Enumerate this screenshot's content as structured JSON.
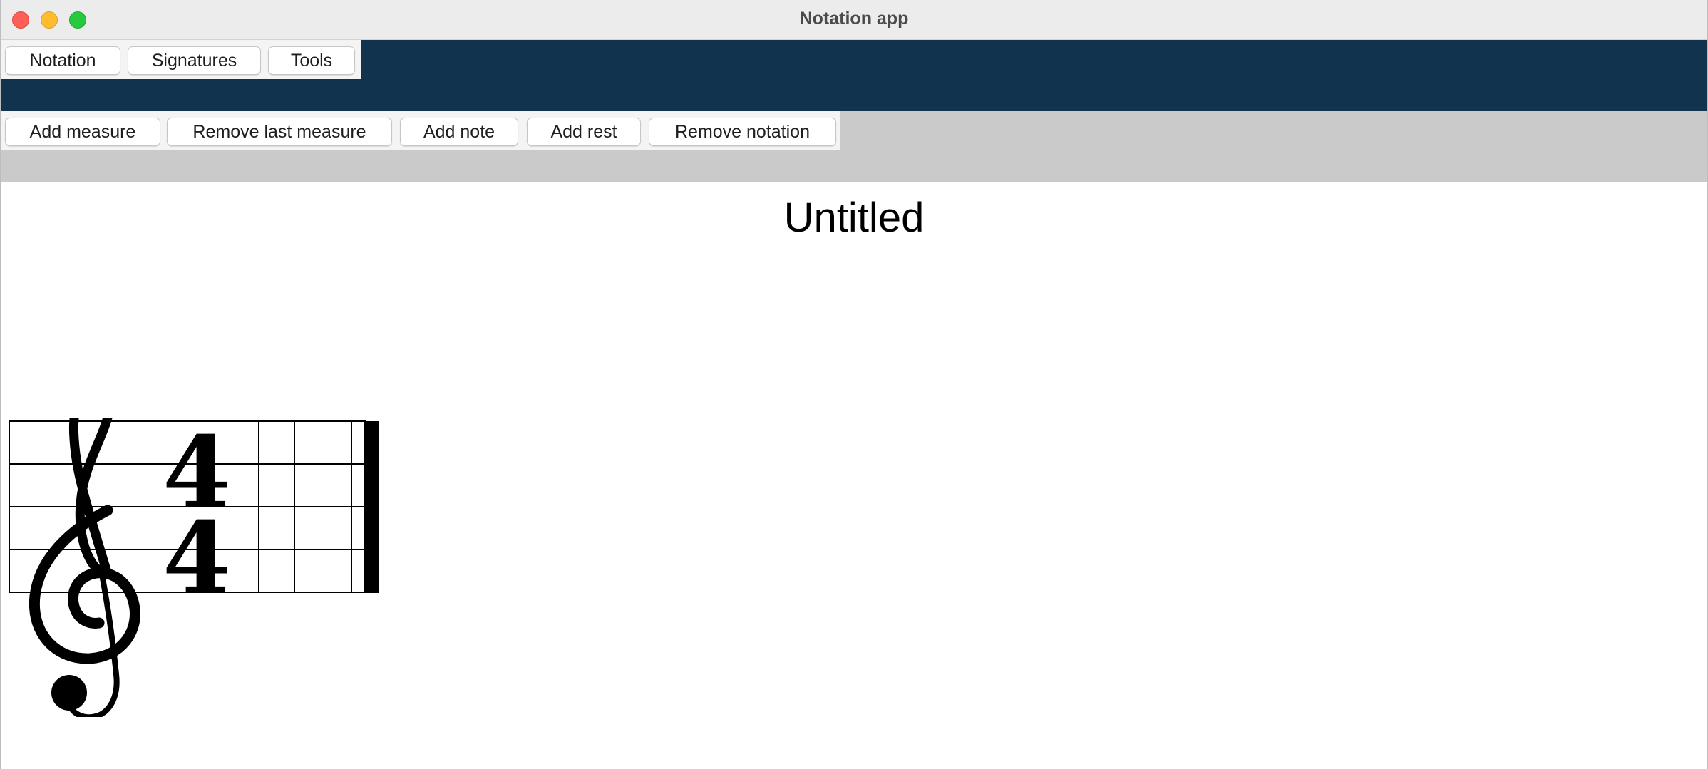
{
  "window": {
    "title": "Notation app"
  },
  "menu": {
    "tabs": [
      {
        "label": "Notation"
      },
      {
        "label": "Signatures"
      },
      {
        "label": "Tools"
      }
    ]
  },
  "toolbar": {
    "buttons": [
      {
        "label": "Add measure"
      },
      {
        "label": "Remove last measure"
      },
      {
        "label": "Add note"
      },
      {
        "label": "Add rest"
      },
      {
        "label": "Remove notation"
      }
    ]
  },
  "score": {
    "title": "Untitled",
    "clef": "treble-clef-icon",
    "time_signature": {
      "numerator": "4",
      "denominator": "4"
    },
    "measures": 2
  },
  "colors": {
    "menu_band": "#12334d",
    "toolbar_band": "#cacaca",
    "close": "#ff5f57",
    "minimize": "#febc2e",
    "maximize": "#28c840"
  }
}
